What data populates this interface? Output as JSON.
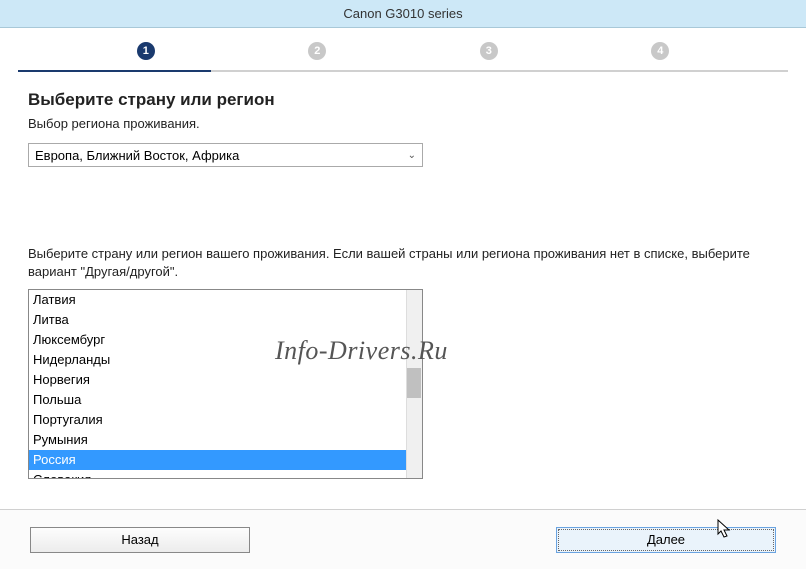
{
  "title": "Canon G3010 series",
  "steps": [
    "1",
    "2",
    "3",
    "4"
  ],
  "active_step": 1,
  "heading": "Выберите страну или регион",
  "subheading": "Выбор региона проживания.",
  "region_select": "Европа, Ближний Восток, Африка",
  "instruction": "Выберите страну или регион вашего проживания. Если вашей страны или региона проживания нет в списке, выберите вариант \"Другая/другой\".",
  "countries": [
    "Латвия",
    "Литва",
    "Люксембург",
    "Нидерланды",
    "Норвегия",
    "Польша",
    "Португалия",
    "Румыния",
    "Россия",
    "Словакия"
  ],
  "selected_country": "Россия",
  "btn_back": "Назад",
  "btn_next": "Далее",
  "watermark": "Info-Drivers.Ru"
}
